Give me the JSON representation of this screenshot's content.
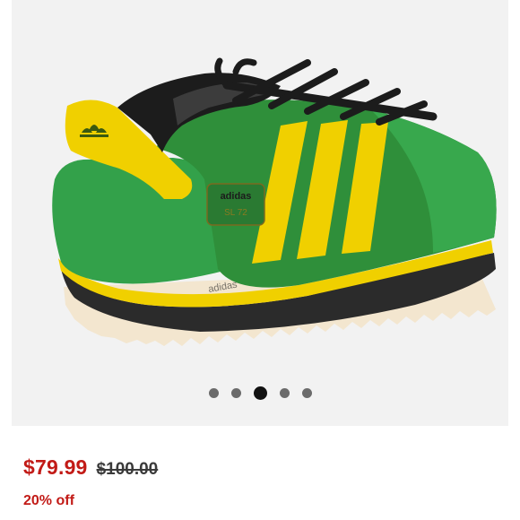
{
  "product_image": {
    "brand_text": "adidas",
    "model_text": "SL 72",
    "colors": {
      "upper_green": "#2f8f3a",
      "suede_green": "#33a14a",
      "stripe_yellow": "#f0d000",
      "lace_black": "#1c1c1c",
      "sole_black": "#2b2b2b",
      "sole_cream": "#f3e6cf"
    }
  },
  "carousel": {
    "count": 5,
    "active_index": 2
  },
  "pricing": {
    "sale_price": "$79.99",
    "original_price": "$100.00",
    "discount": "20% off",
    "colors": {
      "sale": "#c21b17",
      "original": "#3a3a3a"
    }
  }
}
